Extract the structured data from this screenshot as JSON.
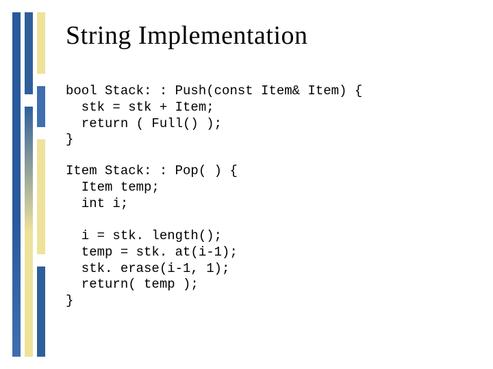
{
  "slide": {
    "title": "String Implementation",
    "code_block_1": "bool Stack: : Push(const Item& Item) {\n  stk = stk + Item;\n  return ( Full() );\n}",
    "code_block_2": "Item Stack: : Pop( ) {\n  Item temp;\n  int i;\n\n  i = stk. length();\n  temp = stk. at(i-1);\n  stk. erase(i-1, 1);\n  return( temp );\n}"
  }
}
